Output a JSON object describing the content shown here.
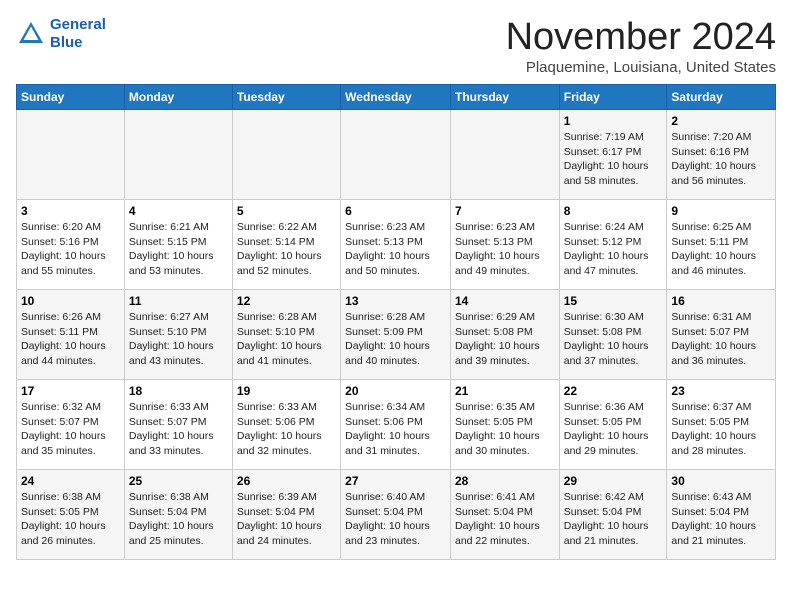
{
  "header": {
    "logo_line1": "General",
    "logo_line2": "Blue",
    "month": "November 2024",
    "location": "Plaquemine, Louisiana, United States"
  },
  "weekdays": [
    "Sunday",
    "Monday",
    "Tuesday",
    "Wednesday",
    "Thursday",
    "Friday",
    "Saturday"
  ],
  "weeks": [
    [
      {
        "day": "",
        "info": ""
      },
      {
        "day": "",
        "info": ""
      },
      {
        "day": "",
        "info": ""
      },
      {
        "day": "",
        "info": ""
      },
      {
        "day": "",
        "info": ""
      },
      {
        "day": "1",
        "info": "Sunrise: 7:19 AM\nSunset: 6:17 PM\nDaylight: 10 hours and 58 minutes."
      },
      {
        "day": "2",
        "info": "Sunrise: 7:20 AM\nSunset: 6:16 PM\nDaylight: 10 hours and 56 minutes."
      }
    ],
    [
      {
        "day": "3",
        "info": "Sunrise: 6:20 AM\nSunset: 5:16 PM\nDaylight: 10 hours and 55 minutes."
      },
      {
        "day": "4",
        "info": "Sunrise: 6:21 AM\nSunset: 5:15 PM\nDaylight: 10 hours and 53 minutes."
      },
      {
        "day": "5",
        "info": "Sunrise: 6:22 AM\nSunset: 5:14 PM\nDaylight: 10 hours and 52 minutes."
      },
      {
        "day": "6",
        "info": "Sunrise: 6:23 AM\nSunset: 5:13 PM\nDaylight: 10 hours and 50 minutes."
      },
      {
        "day": "7",
        "info": "Sunrise: 6:23 AM\nSunset: 5:13 PM\nDaylight: 10 hours and 49 minutes."
      },
      {
        "day": "8",
        "info": "Sunrise: 6:24 AM\nSunset: 5:12 PM\nDaylight: 10 hours and 47 minutes."
      },
      {
        "day": "9",
        "info": "Sunrise: 6:25 AM\nSunset: 5:11 PM\nDaylight: 10 hours and 46 minutes."
      }
    ],
    [
      {
        "day": "10",
        "info": "Sunrise: 6:26 AM\nSunset: 5:11 PM\nDaylight: 10 hours and 44 minutes."
      },
      {
        "day": "11",
        "info": "Sunrise: 6:27 AM\nSunset: 5:10 PM\nDaylight: 10 hours and 43 minutes."
      },
      {
        "day": "12",
        "info": "Sunrise: 6:28 AM\nSunset: 5:10 PM\nDaylight: 10 hours and 41 minutes."
      },
      {
        "day": "13",
        "info": "Sunrise: 6:28 AM\nSunset: 5:09 PM\nDaylight: 10 hours and 40 minutes."
      },
      {
        "day": "14",
        "info": "Sunrise: 6:29 AM\nSunset: 5:08 PM\nDaylight: 10 hours and 39 minutes."
      },
      {
        "day": "15",
        "info": "Sunrise: 6:30 AM\nSunset: 5:08 PM\nDaylight: 10 hours and 37 minutes."
      },
      {
        "day": "16",
        "info": "Sunrise: 6:31 AM\nSunset: 5:07 PM\nDaylight: 10 hours and 36 minutes."
      }
    ],
    [
      {
        "day": "17",
        "info": "Sunrise: 6:32 AM\nSunset: 5:07 PM\nDaylight: 10 hours and 35 minutes."
      },
      {
        "day": "18",
        "info": "Sunrise: 6:33 AM\nSunset: 5:07 PM\nDaylight: 10 hours and 33 minutes."
      },
      {
        "day": "19",
        "info": "Sunrise: 6:33 AM\nSunset: 5:06 PM\nDaylight: 10 hours and 32 minutes."
      },
      {
        "day": "20",
        "info": "Sunrise: 6:34 AM\nSunset: 5:06 PM\nDaylight: 10 hours and 31 minutes."
      },
      {
        "day": "21",
        "info": "Sunrise: 6:35 AM\nSunset: 5:05 PM\nDaylight: 10 hours and 30 minutes."
      },
      {
        "day": "22",
        "info": "Sunrise: 6:36 AM\nSunset: 5:05 PM\nDaylight: 10 hours and 29 minutes."
      },
      {
        "day": "23",
        "info": "Sunrise: 6:37 AM\nSunset: 5:05 PM\nDaylight: 10 hours and 28 minutes."
      }
    ],
    [
      {
        "day": "24",
        "info": "Sunrise: 6:38 AM\nSunset: 5:05 PM\nDaylight: 10 hours and 26 minutes."
      },
      {
        "day": "25",
        "info": "Sunrise: 6:38 AM\nSunset: 5:04 PM\nDaylight: 10 hours and 25 minutes."
      },
      {
        "day": "26",
        "info": "Sunrise: 6:39 AM\nSunset: 5:04 PM\nDaylight: 10 hours and 24 minutes."
      },
      {
        "day": "27",
        "info": "Sunrise: 6:40 AM\nSunset: 5:04 PM\nDaylight: 10 hours and 23 minutes."
      },
      {
        "day": "28",
        "info": "Sunrise: 6:41 AM\nSunset: 5:04 PM\nDaylight: 10 hours and 22 minutes."
      },
      {
        "day": "29",
        "info": "Sunrise: 6:42 AM\nSunset: 5:04 PM\nDaylight: 10 hours and 21 minutes."
      },
      {
        "day": "30",
        "info": "Sunrise: 6:43 AM\nSunset: 5:04 PM\nDaylight: 10 hours and 21 minutes."
      }
    ]
  ]
}
